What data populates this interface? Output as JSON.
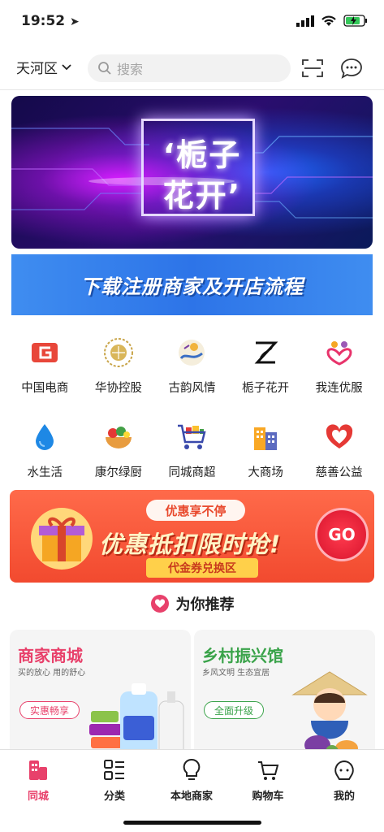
{
  "status": {
    "time": "19:52"
  },
  "header": {
    "location": "天河区",
    "search_placeholder": "搜索"
  },
  "banner": {
    "line1": "‘栀子",
    "line2": "花开’"
  },
  "banner2": {
    "text": "下载注册商家及开店流程"
  },
  "categories_row1": [
    {
      "label": "中国电商",
      "icon": "china-ecommerce-icon"
    },
    {
      "label": "华协控股",
      "icon": "huaxie-holding-icon"
    },
    {
      "label": "古韵风情",
      "icon": "guyun-icon"
    },
    {
      "label": "栀子花开",
      "icon": "zhizi-icon"
    },
    {
      "label": "我连优服",
      "icon": "wolian-icon"
    }
  ],
  "categories_row2": [
    {
      "label": "水生活",
      "icon": "water-drop-icon"
    },
    {
      "label": "康尔绿厨",
      "icon": "green-kitchen-icon"
    },
    {
      "label": "同城商超",
      "icon": "shopping-cart-icon"
    },
    {
      "label": "大商场",
      "icon": "mall-building-icon"
    },
    {
      "label": "慈善公益",
      "icon": "charity-heart-icon"
    }
  ],
  "promo": {
    "top": "优惠享不停",
    "main": "优惠抵扣限时抢!",
    "sub": "代金券兑换区",
    "go": "GO"
  },
  "recommend": {
    "title": "为你推荐"
  },
  "cards": [
    {
      "title": "商家商城",
      "subtitle": "买的放心 用的舒心",
      "button": "实惠畅享",
      "color": "#e8416b"
    },
    {
      "title": "乡村振兴馆",
      "subtitle": "乡风文明 生态宜居",
      "button": "全面升级",
      "color": "#3aa34a"
    }
  ],
  "nav": [
    {
      "label": "同城",
      "active": true
    },
    {
      "label": "分类"
    },
    {
      "label": "本地商家"
    },
    {
      "label": "购物车"
    },
    {
      "label": "我的"
    }
  ],
  "colors": {
    "accent": "#e8416b",
    "nav_active": "#e8416b"
  }
}
